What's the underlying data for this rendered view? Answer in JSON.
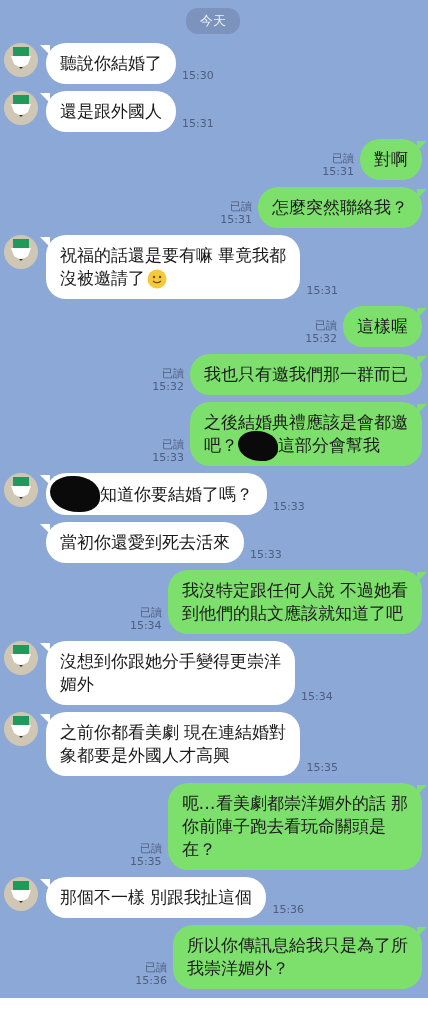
{
  "date_label": "今天",
  "messages": [
    {
      "kind": "in",
      "avatar": true,
      "time": "15:30",
      "lines": [
        [
          {
            "kind": "text",
            "text": "聽說你結婚了"
          }
        ]
      ]
    },
    {
      "kind": "in",
      "avatar": true,
      "time": "15:31",
      "lines": [
        [
          {
            "kind": "text",
            "text": "還是跟外國人"
          }
        ]
      ]
    },
    {
      "kind": "out",
      "read": "已讀",
      "time": "15:31",
      "lines": [
        [
          {
            "kind": "text",
            "text": "對啊"
          }
        ]
      ]
    },
    {
      "kind": "out",
      "read": "已讀",
      "time": "15:31",
      "lines": [
        [
          {
            "kind": "text",
            "text": "怎麼突然聯絡我？"
          }
        ]
      ]
    },
    {
      "kind": "in",
      "avatar": true,
      "time": "15:31",
      "lines": [
        [
          {
            "kind": "text",
            "text": "祝福的話還是要有嘛 畢竟我都"
          }
        ],
        [
          {
            "kind": "text",
            "text": "沒被邀請了"
          },
          {
            "kind": "emoji"
          }
        ]
      ]
    },
    {
      "kind": "out",
      "read": "已讀",
      "time": "15:32",
      "lines": [
        [
          {
            "kind": "text",
            "text": "這樣喔"
          }
        ]
      ]
    },
    {
      "kind": "out",
      "read": "已讀",
      "time": "15:32",
      "lines": [
        [
          {
            "kind": "text",
            "text": "我也只有邀我們那一群而已"
          }
        ]
      ]
    },
    {
      "kind": "out",
      "read": "已讀",
      "time": "15:33",
      "lines": [
        [
          {
            "kind": "text",
            "text": "之後結婚典禮應該是會都邀"
          }
        ],
        [
          {
            "kind": "text",
            "text": "吧？"
          },
          {
            "kind": "redaction"
          },
          {
            "kind": "text",
            "text": "這部分會幫我"
          }
        ]
      ]
    },
    {
      "kind": "in",
      "avatar": true,
      "time": "15:33",
      "lines": [
        [
          {
            "kind": "redaction"
          },
          {
            "kind": "text",
            "text": "知道你要結婚了嗎？"
          }
        ]
      ]
    },
    {
      "kind": "in",
      "avatar": false,
      "time": "15:33",
      "lines": [
        [
          {
            "kind": "text",
            "text": "當初你還愛到死去活來"
          }
        ]
      ]
    },
    {
      "kind": "out",
      "read": "已讀",
      "time": "15:34",
      "lines": [
        [
          {
            "kind": "text",
            "text": "我沒特定跟任何人說 不過她看"
          }
        ],
        [
          {
            "kind": "text",
            "text": "到他們的貼文應該就知道了吧"
          }
        ]
      ]
    },
    {
      "kind": "in",
      "avatar": true,
      "time": "15:34",
      "lines": [
        [
          {
            "kind": "text",
            "text": "沒想到你跟她分手變得更崇洋"
          }
        ],
        [
          {
            "kind": "text",
            "text": "媚外"
          }
        ]
      ]
    },
    {
      "kind": "in",
      "avatar": true,
      "time": "15:35",
      "lines": [
        [
          {
            "kind": "text",
            "text": "之前你都看美劇 現在連結婚對"
          }
        ],
        [
          {
            "kind": "text",
            "text": "象都要是外國人才高興"
          }
        ]
      ]
    },
    {
      "kind": "out",
      "read": "已讀",
      "time": "15:35",
      "lines": [
        [
          {
            "kind": "text",
            "text": "呃…看美劇都崇洋媚外的話 那"
          }
        ],
        [
          {
            "kind": "text",
            "text": "你前陣子跑去看玩命關頭是"
          }
        ],
        [
          {
            "kind": "text",
            "text": "在？"
          }
        ]
      ]
    },
    {
      "kind": "in",
      "avatar": true,
      "time": "15:36",
      "lines": [
        [
          {
            "kind": "text",
            "text": "那個不一樣 別跟我扯這個"
          }
        ]
      ]
    },
    {
      "kind": "out",
      "read": "已讀",
      "time": "15:36",
      "lines": [
        [
          {
            "kind": "text",
            "text": "所以你傳訊息給我只是為了所"
          }
        ],
        [
          {
            "kind": "text",
            "text": "我崇洋媚外？"
          }
        ]
      ]
    }
  ]
}
